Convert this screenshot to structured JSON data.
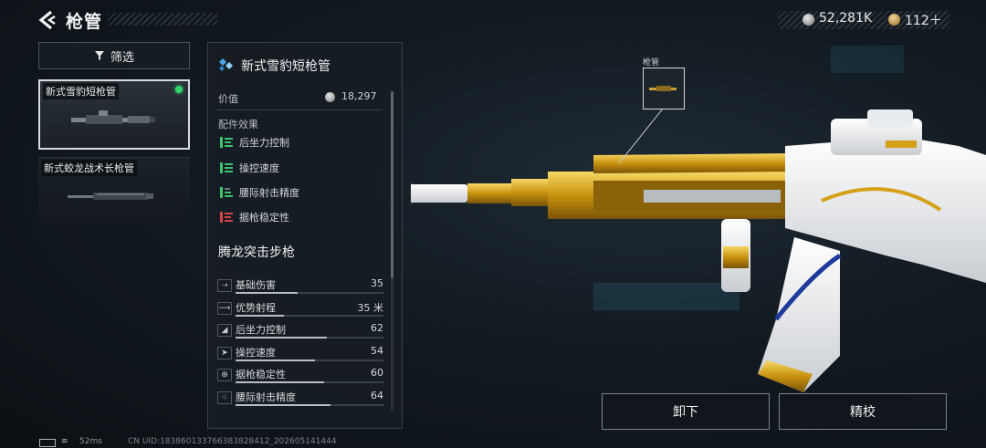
{
  "header": {
    "title": "枪管",
    "back_icon": "back-arrow-icon",
    "currency": [
      {
        "icon": "silver-coin-icon",
        "value": "52,281K"
      },
      {
        "icon": "gold-coin-icon",
        "value": "112＋"
      }
    ]
  },
  "filter": {
    "label": "筛选",
    "icon": "filter-icon"
  },
  "list": {
    "items": [
      {
        "label": "新式雪豹短枪管",
        "selected": true,
        "equipped": true
      },
      {
        "label": "新式蛟龙战术长枪管",
        "selected": false,
        "equipped": false
      }
    ]
  },
  "details": {
    "part_name": "新式雪豹短枪管",
    "value_label": "价值",
    "value": "18,297",
    "effects_label": "配件效果",
    "effects": [
      {
        "label": "后坐力控制",
        "effect": "up"
      },
      {
        "label": "操控速度",
        "effect": "up"
      },
      {
        "label": "腰际射击精度",
        "effect": "up"
      },
      {
        "label": "据枪稳定性",
        "effect": "down"
      }
    ],
    "gun_name": "腾龙突击步枪",
    "stats": [
      {
        "label": "基础伤害",
        "value": "35",
        "fill": 0.42
      },
      {
        "label": "优势射程",
        "value": "35 米",
        "fill": 0.33
      },
      {
        "label": "后坐力控制",
        "value": "62",
        "fill": 0.62
      },
      {
        "label": "操控速度",
        "value": "54",
        "fill": 0.54
      },
      {
        "label": "据枪稳定性",
        "value": "60",
        "fill": 0.6
      },
      {
        "label": "腰际射击精度",
        "value": "64",
        "fill": 0.64
      }
    ]
  },
  "weapon_view": {
    "slot_label": "枪管"
  },
  "actions": {
    "unequip": "卸下",
    "refine": "精校"
  },
  "footer": {
    "ping": "52ms",
    "uid": "CN UID:18386013376638382841​2_202605141444"
  },
  "colors": {
    "up": "#3ec46d",
    "down": "#d64545",
    "equipped": "#34d36a",
    "gold": "#d4a017"
  }
}
